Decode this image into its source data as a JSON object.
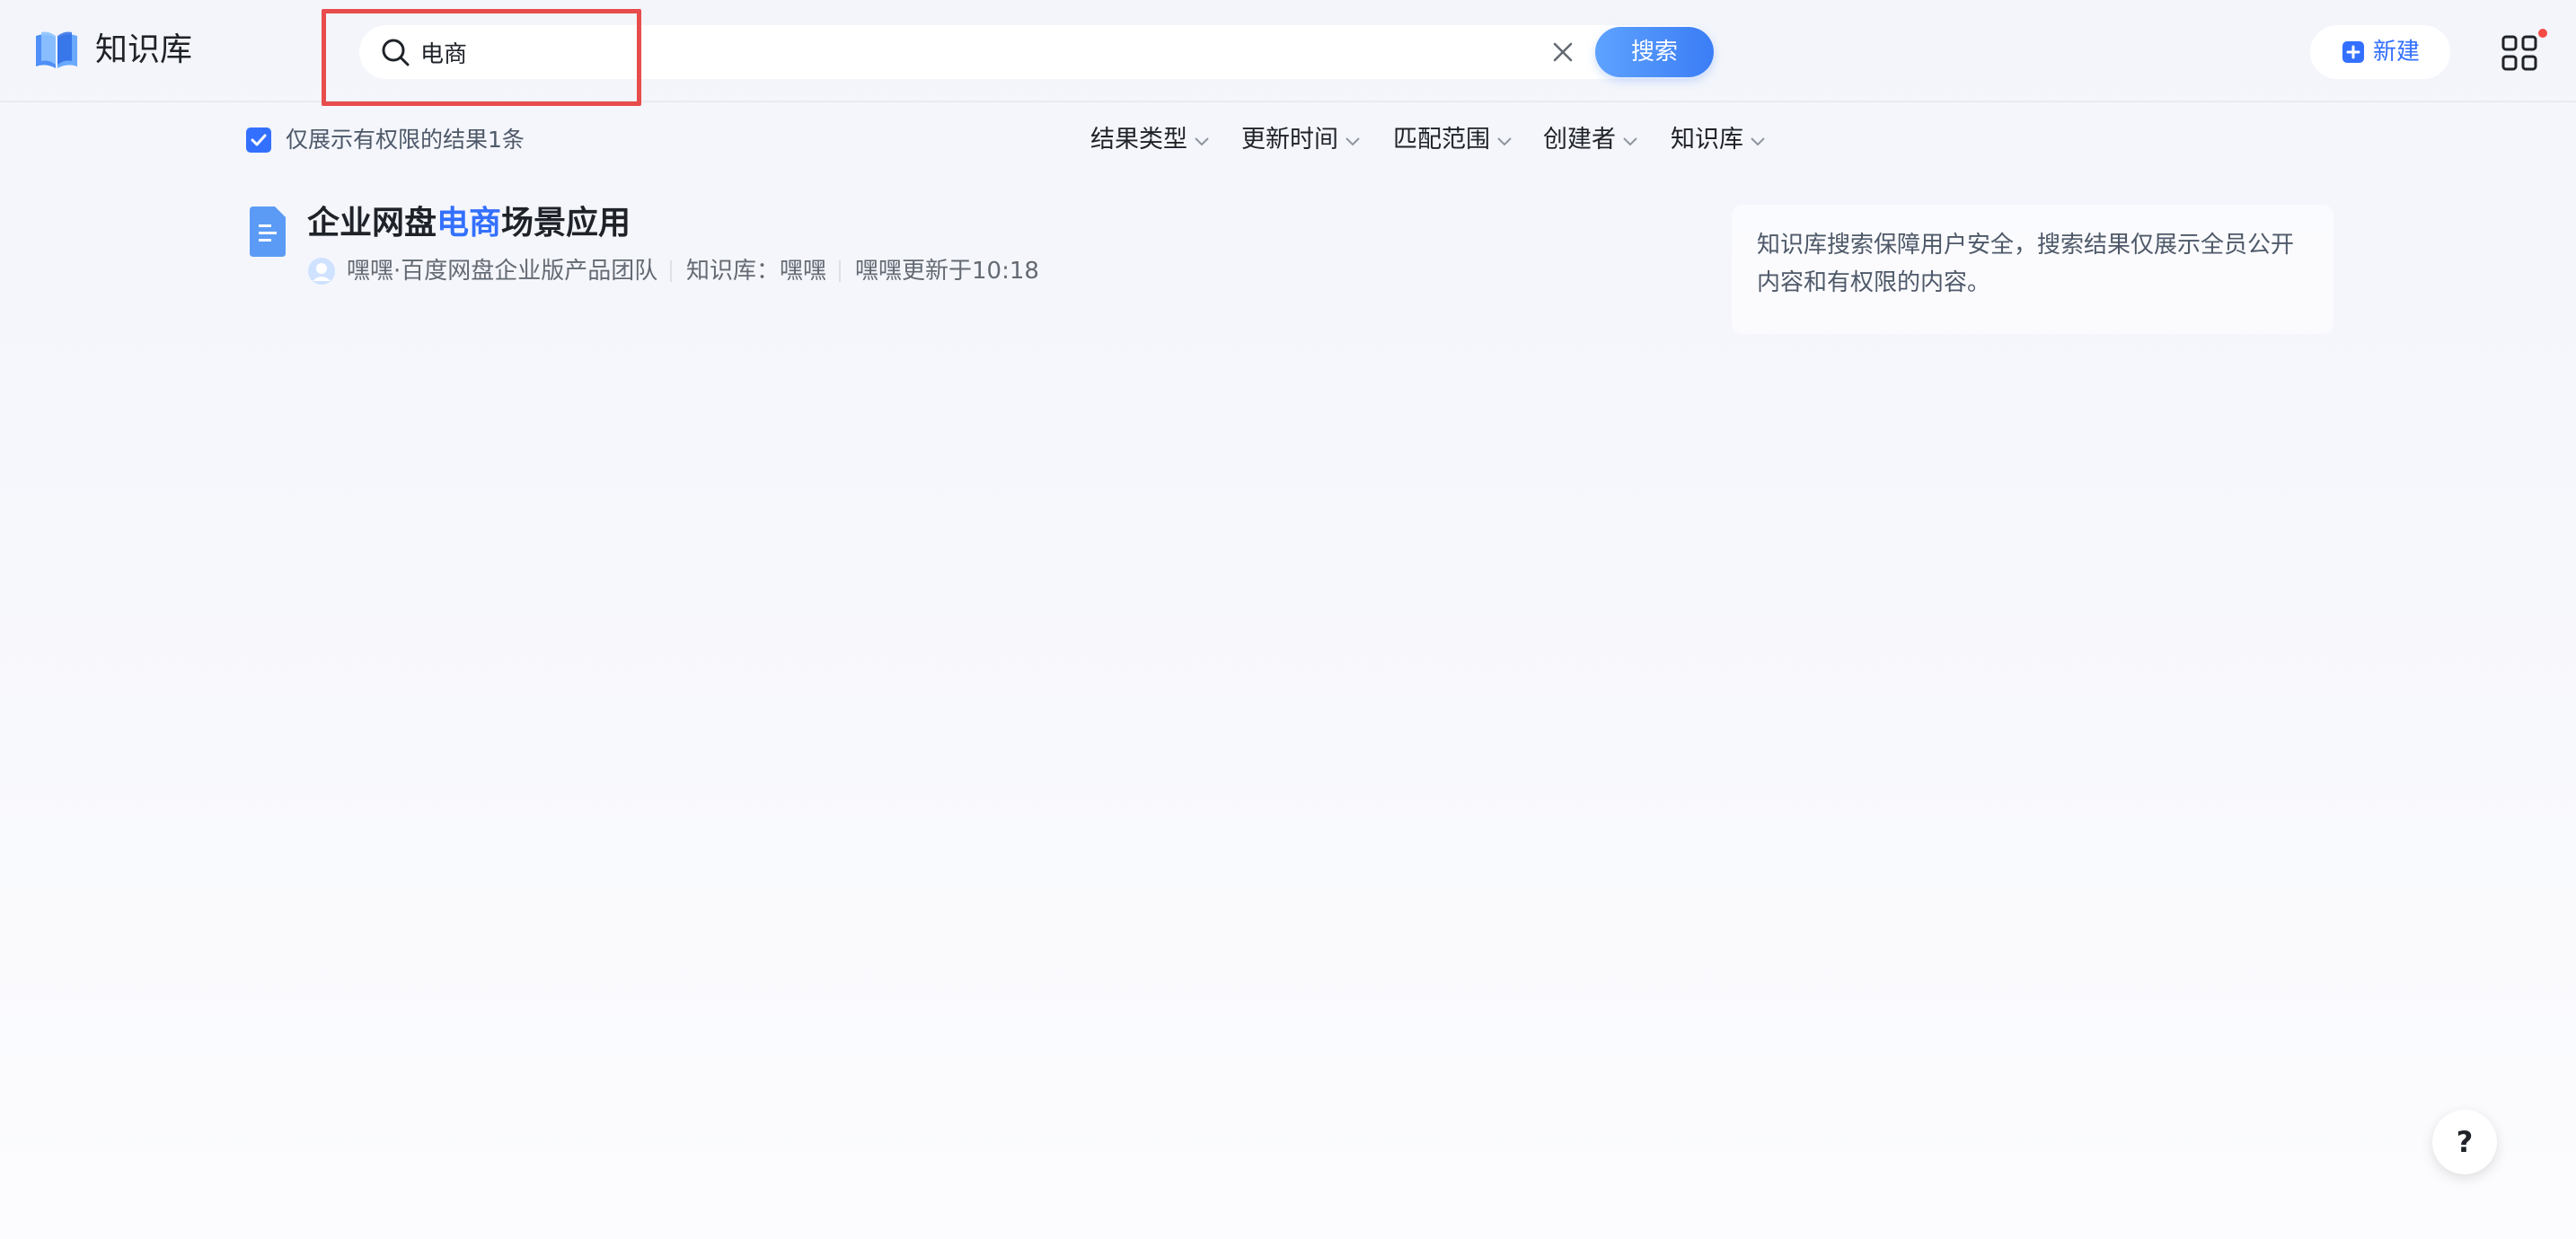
{
  "header": {
    "logo_icon": "book-logo-icon",
    "title": "知识库",
    "search": {
      "value": "电商",
      "placeholder": "",
      "button_label": "搜索",
      "clear_icon": "close-icon"
    },
    "new_button_label": "新建",
    "apps_icon": "grid-apps-icon",
    "apps_badge_color": "#f54a45"
  },
  "filter_bar": {
    "permission_checked": true,
    "permission_label": "仅展示有权限的结果1条",
    "filters": [
      {
        "label": "结果类型"
      },
      {
        "label": "更新时间"
      },
      {
        "label": "匹配范围"
      },
      {
        "label": "创建者"
      },
      {
        "label": "知识库"
      }
    ]
  },
  "results": [
    {
      "title_prefix": "企业网盘",
      "title_match": "电商",
      "title_suffix": "场景应用",
      "author": "嘿嘿·百度网盘企业版产品团队",
      "space": "知识库：嘿嘿",
      "updated": "嘿嘿更新于10:18"
    }
  ],
  "notice": {
    "text": "知识库搜索保障用户安全，搜索结果仅展示全员公开内容和有权限的内容。"
  },
  "help_button": "?",
  "colors": {
    "accent": "#3370ff",
    "highlight_frame": "#e84c4c"
  }
}
